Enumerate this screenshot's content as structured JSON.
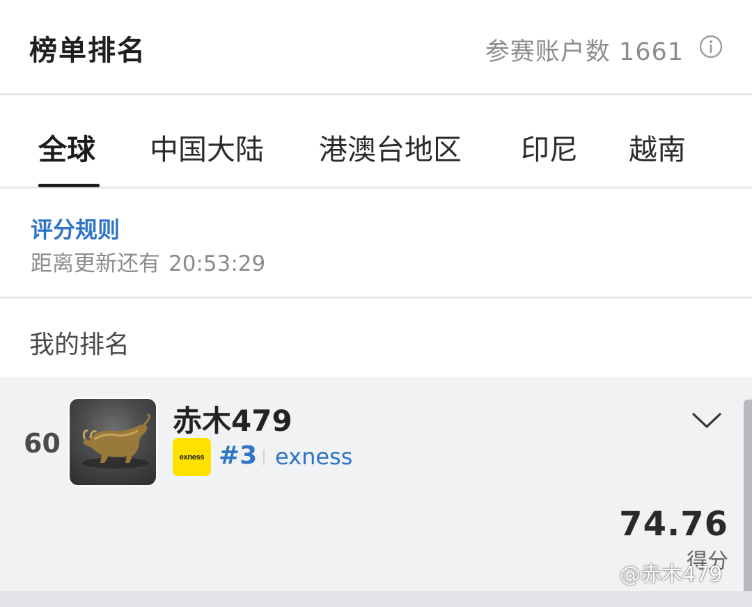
{
  "header": {
    "title": "榜单排名",
    "participant_count_text": "参赛账户数 1661",
    "info_icon": "info-icon"
  },
  "tabs": [
    {
      "label": "全球",
      "active": true
    },
    {
      "label": "中国大陆",
      "active": false
    },
    {
      "label": "港澳台地区",
      "active": false
    },
    {
      "label": "印尼",
      "active": false
    },
    {
      "label": "越南",
      "active": false
    }
  ],
  "rules": {
    "link_label": "评分规则",
    "countdown_label": "距离更新还有",
    "countdown_time": "20:53:29"
  },
  "my_rank": {
    "section_label": "我的排名",
    "rank": "60",
    "avatar_icon": "bull-avatar",
    "username": "赤木479",
    "broker_logo_text": "exness",
    "broker_rank": "#3",
    "broker_name": "exness",
    "score": "74.76",
    "score_label": "得分",
    "expand_icon": "chevron-down-icon"
  },
  "watermark": "@赤木479",
  "colors": {
    "accent_blue": "#2f74c6",
    "broker_yellow": "#ffe100",
    "card_bg": "#f1f2f4",
    "muted_text": "#8a8c90"
  }
}
